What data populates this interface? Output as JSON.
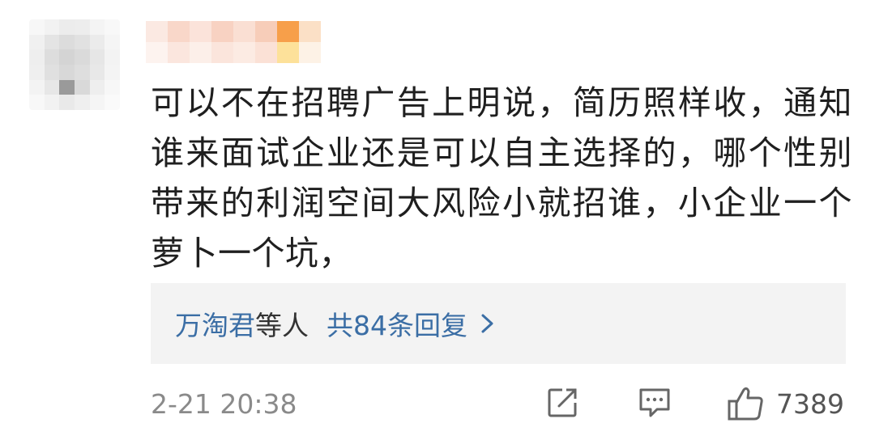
{
  "comment": {
    "text": "可以不在招聘广告上明说，简历照样收，通知谁来面试企业还是可以自主选择的，哪个性别带来的利润空间大风险小就招谁，小企业一个萝卜一个坑，"
  },
  "replies": {
    "names": "万淘君",
    "others": "等人",
    "count_text": "共84条回复"
  },
  "footer": {
    "timestamp": "2-21 20:38",
    "like_count": "7389",
    "icons": [
      "share-icon",
      "comment-icon",
      "like-icon"
    ]
  },
  "colors": {
    "link": "#3b6ea5",
    "text": "#1f1f1f",
    "meta": "#8a8a8a",
    "reply_bg": "#f3f3f3"
  }
}
